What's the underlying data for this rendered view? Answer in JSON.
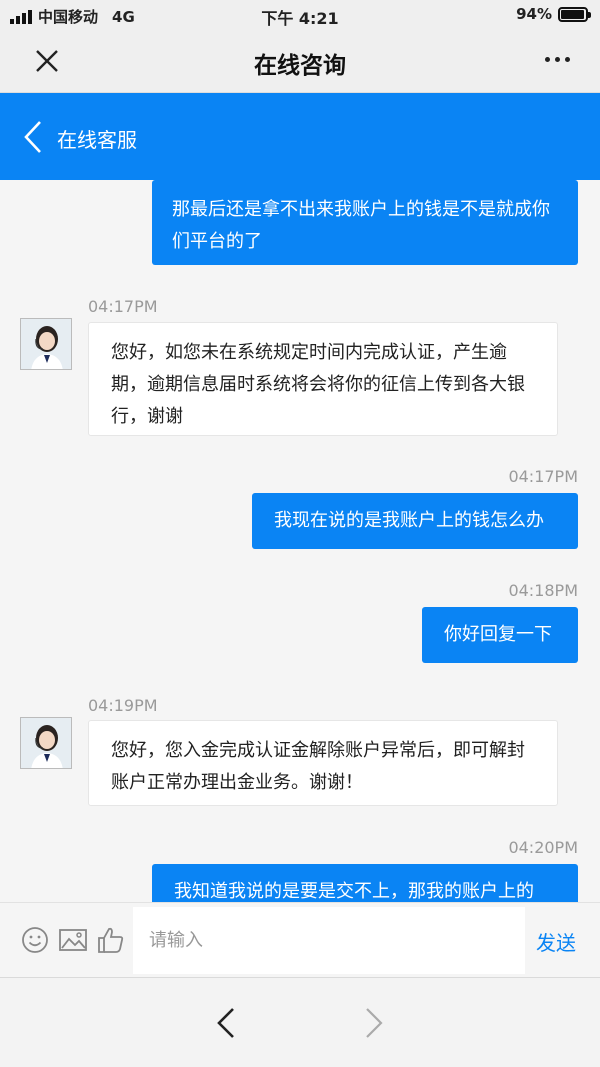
{
  "status_bar": {
    "carrier": "中国移动",
    "network": "4G",
    "time": "下午 4:21",
    "battery": "94%",
    "battery_level": 0.94
  },
  "nav_bar": {
    "title": "在线咨询",
    "close_icon": "close-icon",
    "more_icon": "more-icon"
  },
  "chat_header": {
    "back_icon": "chevron-left-icon",
    "title": "在线客服",
    "color": "#0a84f4"
  },
  "messages": [
    {
      "direction": "outgoing",
      "text": "那最后还是拿不出来我账户上的钱是不是就成你们平台的了"
    },
    {
      "direction": "incoming",
      "time": "04:17PM",
      "text": "您好，如您未在系统规定时间内完成认证，产生逾期，逾期信息届时系统将会将你的征信上传到各大银行，谢谢"
    },
    {
      "direction": "outgoing",
      "time": "04:17PM",
      "text": "我现在说的是我账户上的钱怎么办"
    },
    {
      "direction": "outgoing",
      "time": "04:18PM",
      "text": "你好回复一下"
    },
    {
      "direction": "incoming",
      "time": "04:19PM",
      "text": "您好，您入金完成认证金解除账户异常后，即可解封账户正常办理出金业务。谢谢！"
    },
    {
      "direction": "outgoing",
      "time": "04:20PM",
      "text": "我知道我说的是要是交不上，那我的账户上的"
    }
  ],
  "composer": {
    "placeholder": "请输入",
    "value": "",
    "send_label": "发送",
    "icons": [
      "emoji-icon",
      "image-icon",
      "thumbs-up-icon"
    ]
  },
  "browser_nav": {
    "back_icon": "chevron-left-icon",
    "forward_icon": "chevron-right-icon"
  },
  "colors": {
    "accent": "#0a84f4",
    "background": "#f5f5f5"
  }
}
